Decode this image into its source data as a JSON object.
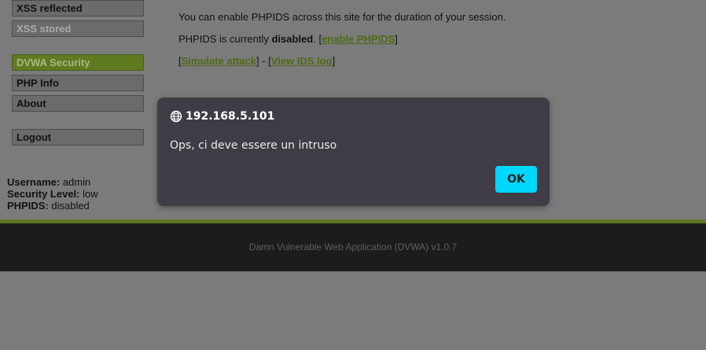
{
  "menu": {
    "items": [
      {
        "label": "XSS reflected"
      },
      {
        "label": "XSS stored"
      },
      {
        "label": "DVWA Security"
      },
      {
        "label": "PHP Info"
      },
      {
        "label": "About"
      },
      {
        "label": "Logout"
      }
    ]
  },
  "content": {
    "line1": "You can enable PHPIDS across this site for the duration of your session.",
    "line2_prefix": "PHPIDS is currently ",
    "line2_status": "disabled",
    "line2_mid": ". [",
    "line2_link": "enable PHPIDS",
    "line2_end": "]",
    "line3_open": "[",
    "line3_link1": "Simulate attack",
    "line3_mid": "] - [",
    "line3_link2": "View IDS log",
    "line3_end": "]"
  },
  "user_info": {
    "username_label": "Username:",
    "username_value": "admin",
    "security_label": "Security Level:",
    "security_value": "low",
    "phpids_label": "PHPIDS:",
    "phpids_value": "disabled"
  },
  "footer": {
    "text": "Damn Vulnerable Web Application (DVWA) v1.0.7"
  },
  "dialog": {
    "icon": "globe-icon",
    "title": "192.168.5.101",
    "message": "Ops, ci deve essere un intruso",
    "ok_label": "OK"
  },
  "colors": {
    "accent_green": "#5c7820",
    "ok_button": "#00d7ff",
    "dialog_bg": "#3f3c45",
    "footer_bg": "#1c1c1c"
  }
}
